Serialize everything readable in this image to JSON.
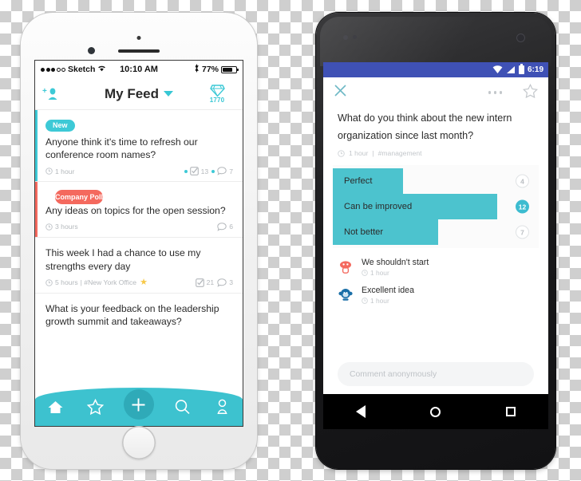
{
  "iphone": {
    "status_bar": {
      "carrier": "Sketch",
      "time": "10:10 AM",
      "battery_pct": "77%",
      "wifi_icon": "wifi-icon",
      "bluetooth_icon": "bluetooth-icon"
    },
    "nav": {
      "add_person_icon": "add-person-icon",
      "title": "My Feed",
      "dropdown_icon": "chevron-down-icon",
      "gem_icon": "diamond-icon",
      "gem_count": "1770"
    },
    "feed": [
      {
        "badge": "New",
        "badge_type": "new",
        "accent_color": "#3dc9d6",
        "text": "Anyone think it's time to refresh our conference room names?",
        "time": "1 hour",
        "tag": "",
        "starred": false,
        "votes": "13",
        "comments": "7",
        "vote_icon": "checkbox-icon",
        "comment_icon": "comment-bubble-icon",
        "clock_icon": "clock-icon"
      },
      {
        "badge": "Company Poll",
        "badge_type": "poll",
        "accent_color": "#f4695e",
        "text": "Any ideas on topics for the open session?",
        "time": "3 hours",
        "tag": "",
        "starred": false,
        "votes": "",
        "comments": "6",
        "vote_icon": "checkbox-icon",
        "comment_icon": "comment-bubble-icon",
        "clock_icon": "clock-icon"
      },
      {
        "badge": "",
        "badge_type": "",
        "accent_color": "transparent",
        "text": "This week I had a chance to use my strengths every day",
        "time": "5 hours",
        "tag": "| #New York Office",
        "starred": true,
        "votes": "21",
        "comments": "3",
        "vote_icon": "checkbox-icon",
        "comment_icon": "comment-bubble-icon",
        "clock_icon": "clock-icon",
        "star_icon": "star-filled-icon"
      },
      {
        "badge": "",
        "badge_type": "",
        "accent_color": "transparent",
        "text": "What is your feedback on the leadership growth summit and takeaways?",
        "time": "",
        "tag": "",
        "starred": false,
        "votes": "",
        "comments": "",
        "vote_icon": "",
        "comment_icon": "",
        "clock_icon": ""
      }
    ],
    "tabbar": {
      "color": "#3dc2cf",
      "items": [
        {
          "icon": "home-icon",
          "label": "Home",
          "active": true
        },
        {
          "icon": "star-outline-icon",
          "label": "Favorites",
          "active": false
        },
        {
          "icon": "plus-icon",
          "label": "Create",
          "active": false
        },
        {
          "icon": "search-icon",
          "label": "Search",
          "active": false
        },
        {
          "icon": "profile-icon",
          "label": "Profile",
          "active": false
        }
      ]
    }
  },
  "android": {
    "status_bar": {
      "time": "6:19",
      "wifi_icon": "wifi-icon",
      "signal_icon": "cellular-signal-icon",
      "battery_icon": "battery-icon",
      "color": "#3f51b5"
    },
    "appbar": {
      "close_icon": "close-x-icon",
      "overflow_icon": "more-options-icon",
      "star_icon": "star-outline-icon"
    },
    "post": {
      "question": "What do you think about the new intern organization since last month?",
      "time": "1 hour",
      "separator": "|",
      "tag": "#management",
      "clock_icon": "clock-icon"
    },
    "poll": {
      "bar_color": "#4cc3ce",
      "options": [
        {
          "label": "Perfect",
          "count": "4",
          "pct": 34,
          "selected": false
        },
        {
          "label": "Can be improved",
          "count": "12",
          "pct": 80,
          "selected": true
        },
        {
          "label": "Not better",
          "count": "7",
          "pct": 51,
          "selected": false
        }
      ]
    },
    "comments": [
      {
        "text": "We shouldn't start",
        "time": "1 hour",
        "avatar_icon": "mushroom-avatar-icon",
        "avatar_color": "#f4695e",
        "clock_icon": "clock-icon"
      },
      {
        "text": "Excellent idea",
        "time": "1 hour",
        "avatar_icon": "monkey-avatar-icon",
        "avatar_color": "#1a6fa8",
        "clock_icon": "clock-icon"
      }
    ],
    "comment_box": {
      "placeholder": "Comment anonymously"
    },
    "navbar": {
      "back_icon": "back-triangle-icon",
      "home_icon": "home-circle-icon",
      "recent_icon": "recent-square-icon"
    }
  }
}
